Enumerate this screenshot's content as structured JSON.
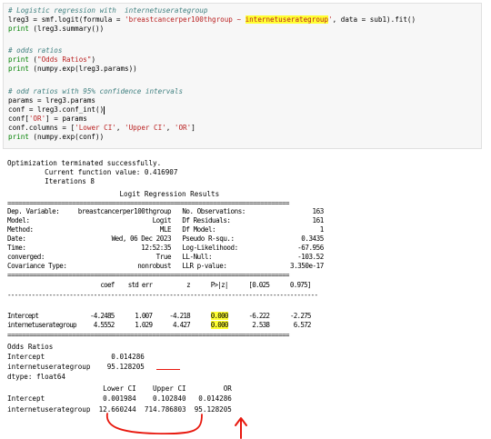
{
  "code": {
    "c1": "# Logistic regression with  internetuserategroup",
    "l1_a": "lreg3 = smf.logit(formula = ",
    "l1_str_a": "'breastcancerper100thgroup ~ ",
    "l1_str_hl": "internetuserategroup",
    "l1_str_b": "'",
    "l1_b": ", data = sub1).fit()",
    "l2_kw": "print",
    "l2_rest": " (lreg3.summary())",
    "c2": "# odds ratios",
    "l3_kw": "print",
    "l3_a": " (",
    "l3_str": "\"Odds Ratios\"",
    "l3_b": ")",
    "l4_kw": "print",
    "l4_rest": " (numpy.exp(lreg3.params))",
    "c3": "# odd ratios with 95% confidence intervals",
    "l5": "params = lreg3.params",
    "l6": "conf = lreg3.conf_int()",
    "l7_a": "conf[",
    "l7_str": "'OR'",
    "l7_b": "] = params",
    "l8_a": "conf.columns = [",
    "l8_s1": "'Lower CI'",
    "l8_c1": ", ",
    "l8_s2": "'Upper CI'",
    "l8_c2": ", ",
    "l8_s3": "'OR'",
    "l8_b": "]",
    "l9_kw": "print",
    "l9_rest": " (numpy.exp(conf))"
  },
  "output": {
    "o1": "Optimization terminated successfully.",
    "o2": "         Current function value: 0.416907",
    "o3": "         Iterations 8",
    "o4": "                           Logit Regression Results",
    "sep_eq": "==============================================================================",
    "r1": "Dep. Variable:     breastcancerper100thgroup   No. Observations:                  163",
    "r2": "Model:                                 Logit   Df Residuals:                      161",
    "r3": "Method:                                  MLE   Df Model:                            1",
    "r4": "Date:                       Wed, 06 Dec 2023   Pseudo R-squ.:                  0.3435",
    "r5": "Time:                               12:52:35   Log-Likelihood:                -67.956",
    "r6": "converged:                              True   LL-Null:                       -103.52",
    "r7": "Covariance Type:                   nonrobust   LLR p-value:                 3.350e-17",
    "h1": "                           coef    std err          z      P>|z|      [0.025      0.975]",
    "sep_dash": "------------------------------------------------------------------------------------------",
    "p1_a": "Intercept               -4.2485      1.007     -4.218      ",
    "p1_p": "0.000",
    "p1_b": "      -6.222      -2.275",
    "p2_a": "internetuserategroup     4.5552      1.029      4.427      ",
    "p2_p": "0.000",
    "p2_b": "       2.538       6.572",
    "or_title": "Odds Ratios",
    "or1": "Intercept                0.014286",
    "or2": "internetuserategroup    95.128205",
    "dtype": "dtype: float64",
    "ci_h": "                       Lower CI    Upper CI         OR",
    "ci1": "Intercept              0.001984    0.102840   0.014286",
    "ci2": "internetuserategroup  12.660244  714.786803  95.128205"
  },
  "colors": {
    "highlight": "#ffff33",
    "annotation": "#e8190f"
  }
}
